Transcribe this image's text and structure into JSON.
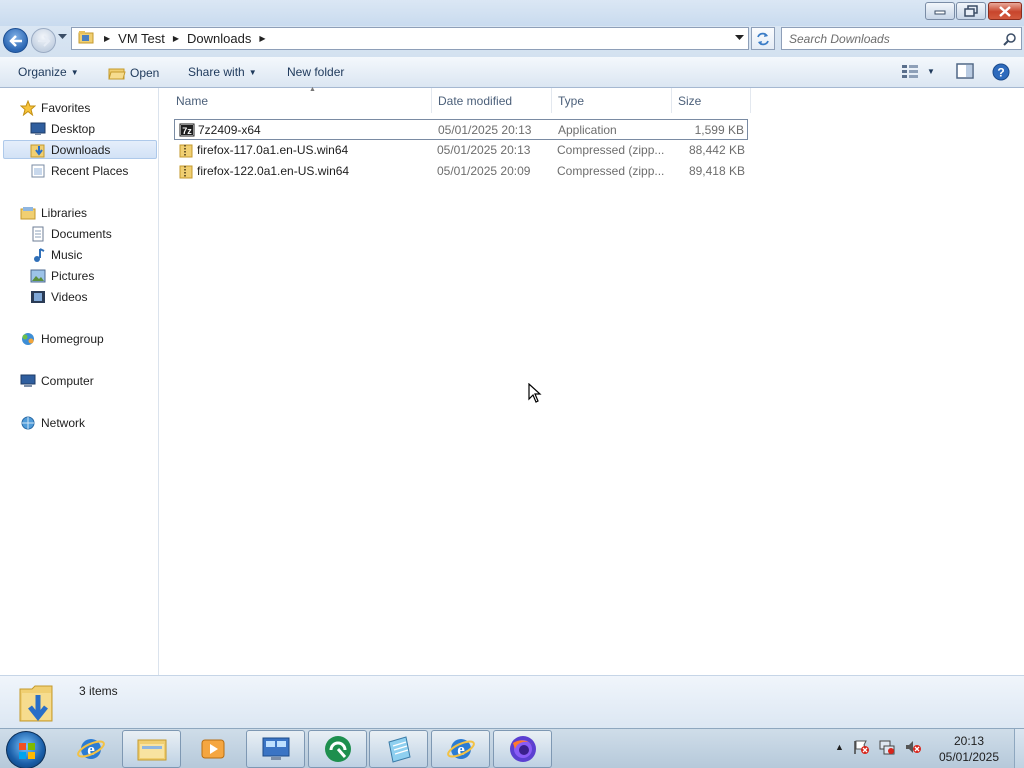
{
  "window": {
    "controls": [
      "minimize",
      "maximize",
      "close"
    ]
  },
  "address": {
    "crumbs": [
      "VM Test",
      "Downloads"
    ],
    "search_placeholder": "Search Downloads"
  },
  "toolbar": {
    "organize": "Organize",
    "open": "Open",
    "share_with": "Share with",
    "new_folder": "New folder"
  },
  "nav": {
    "favorites": "Favorites",
    "desktop": "Desktop",
    "downloads": "Downloads",
    "recent_places": "Recent Places",
    "libraries": "Libraries",
    "documents": "Documents",
    "music": "Music",
    "pictures": "Pictures",
    "videos": "Videos",
    "homegroup": "Homegroup",
    "computer": "Computer",
    "network": "Network"
  },
  "columns": {
    "name": "Name",
    "date_modified": "Date modified",
    "type": "Type",
    "size": "Size"
  },
  "files": [
    {
      "name": "7z2409-x64",
      "date": "05/01/2025 20:13",
      "type": "Application",
      "size": "1,599 KB",
      "icon": "7zip-installer-icon"
    },
    {
      "name": "firefox-117.0a1.en-US.win64",
      "date": "05/01/2025 20:13",
      "type": "Compressed (zipp...",
      "size": "88,442 KB",
      "icon": "zip-folder-icon"
    },
    {
      "name": "firefox-122.0a1.en-US.win64",
      "date": "05/01/2025 20:09",
      "type": "Compressed (zipp...",
      "size": "89,418 KB",
      "icon": "zip-folder-icon"
    }
  ],
  "status": {
    "count": "3 items"
  },
  "clock": {
    "time": "20:13",
    "date": "05/01/2025"
  },
  "colors": {
    "accent": "#1e395b",
    "selection": "#d2e2f6"
  }
}
